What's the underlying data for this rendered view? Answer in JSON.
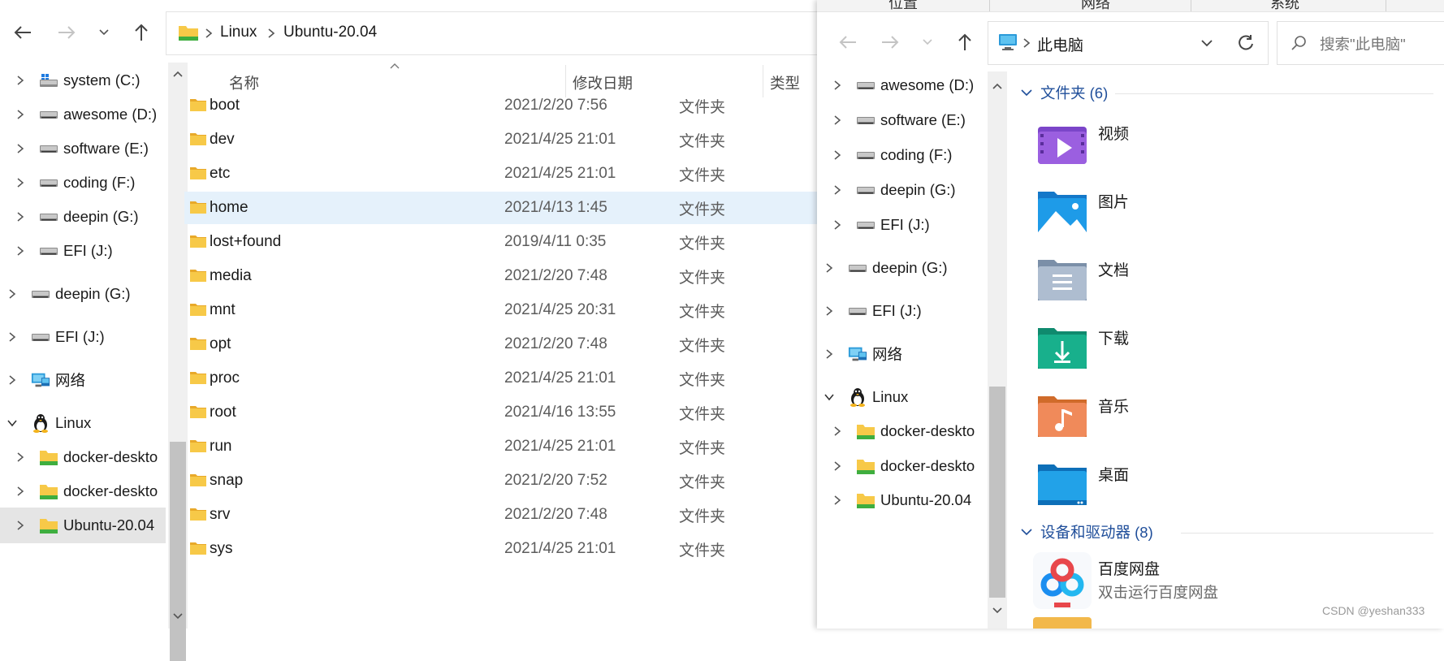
{
  "left_window": {
    "breadcrumb": [
      "Linux",
      "Ubuntu-20.04"
    ],
    "nav_tree": [
      {
        "label": "system (C:)",
        "icon": "windows-drive-icon",
        "level": 1,
        "expanded": false
      },
      {
        "label": "awesome (D:)",
        "icon": "drive-icon",
        "level": 1,
        "expanded": false
      },
      {
        "label": "software (E:)",
        "icon": "drive-icon",
        "level": 1,
        "expanded": false
      },
      {
        "label": "coding (F:)",
        "icon": "drive-icon",
        "level": 1,
        "expanded": false
      },
      {
        "label": "deepin (G:)",
        "icon": "drive-icon",
        "level": 1,
        "expanded": false
      },
      {
        "label": "EFI (J:)",
        "icon": "drive-icon",
        "level": 1,
        "expanded": false
      },
      {
        "label": "deepin (G:)",
        "icon": "drive-icon",
        "level": 0,
        "expanded": false
      },
      {
        "label": "EFI (J:)",
        "icon": "drive-icon",
        "level": 0,
        "expanded": false
      },
      {
        "label": "网络",
        "icon": "network-icon",
        "level": 0,
        "expanded": false
      },
      {
        "label": "Linux",
        "icon": "linux-penguin-icon",
        "level": 0,
        "expanded": true
      },
      {
        "label": "docker-deskto",
        "icon": "wsl-folder-icon",
        "level": 1,
        "expanded": false
      },
      {
        "label": "docker-deskto",
        "icon": "wsl-folder-icon",
        "level": 1,
        "expanded": false
      },
      {
        "label": "Ubuntu-20.04",
        "icon": "wsl-folder-icon",
        "level": 1,
        "expanded": false,
        "selected": true
      }
    ],
    "columns": {
      "name": "名称",
      "date": "修改日期",
      "type": "类型"
    },
    "files": [
      {
        "name": "boot",
        "date": "2021/2/20 7:56",
        "type": "文件夹"
      },
      {
        "name": "dev",
        "date": "2021/4/25 21:01",
        "type": "文件夹"
      },
      {
        "name": "etc",
        "date": "2021/4/25 21:01",
        "type": "文件夹"
      },
      {
        "name": "home",
        "date": "2021/4/13 1:45",
        "type": "文件夹",
        "selected": true
      },
      {
        "name": "lost+found",
        "date": "2019/4/11 0:35",
        "type": "文件夹"
      },
      {
        "name": "media",
        "date": "2021/2/20 7:48",
        "type": "文件夹"
      },
      {
        "name": "mnt",
        "date": "2021/4/25 20:31",
        "type": "文件夹"
      },
      {
        "name": "opt",
        "date": "2021/2/20 7:48",
        "type": "文件夹"
      },
      {
        "name": "proc",
        "date": "2021/4/25 21:01",
        "type": "文件夹"
      },
      {
        "name": "root",
        "date": "2021/4/16 13:55",
        "type": "文件夹"
      },
      {
        "name": "run",
        "date": "2021/4/25 21:01",
        "type": "文件夹"
      },
      {
        "name": "snap",
        "date": "2021/2/20 7:52",
        "type": "文件夹"
      },
      {
        "name": "srv",
        "date": "2021/2/20 7:48",
        "type": "文件夹"
      },
      {
        "name": "sys",
        "date": "2021/4/25 21:01",
        "type": "文件夹"
      }
    ]
  },
  "right_window": {
    "tabs": [
      "位置",
      "网络",
      "系统"
    ],
    "address": "此电脑",
    "search_placeholder": "搜索\"此电脑\"",
    "nav_tree": [
      {
        "label": "awesome (D:)",
        "icon": "drive-icon",
        "level": 1
      },
      {
        "label": "software (E:)",
        "icon": "drive-icon",
        "level": 1
      },
      {
        "label": "coding (F:)",
        "icon": "drive-icon",
        "level": 1
      },
      {
        "label": "deepin (G:)",
        "icon": "drive-icon",
        "level": 1
      },
      {
        "label": "EFI (J:)",
        "icon": "drive-icon",
        "level": 1
      },
      {
        "label": "deepin (G:)",
        "icon": "drive-icon",
        "level": 0
      },
      {
        "label": "EFI (J:)",
        "icon": "drive-icon",
        "level": 0
      },
      {
        "label": "网络",
        "icon": "network-icon",
        "level": 0
      },
      {
        "label": "Linux",
        "icon": "linux-penguin-icon",
        "level": 0,
        "expanded": true
      },
      {
        "label": "docker-deskto",
        "icon": "wsl-folder-icon",
        "level": 1
      },
      {
        "label": "docker-deskto",
        "icon": "wsl-folder-icon",
        "level": 1
      },
      {
        "label": "Ubuntu-20.04",
        "icon": "wsl-folder-icon",
        "level": 1
      }
    ],
    "folders_group": {
      "title": "文件夹 (6)"
    },
    "folders": [
      {
        "label": "视频",
        "icon": "videos-folder-icon"
      },
      {
        "label": "图片",
        "icon": "pictures-folder-icon"
      },
      {
        "label": "文档",
        "icon": "documents-folder-icon"
      },
      {
        "label": "下载",
        "icon": "downloads-folder-icon"
      },
      {
        "label": "音乐",
        "icon": "music-folder-icon"
      },
      {
        "label": "桌面",
        "icon": "desktop-folder-icon"
      }
    ],
    "devices_group": {
      "title": "设备和驱动器 (8)"
    },
    "devices": [
      {
        "name": "百度网盘",
        "subtitle": "双击运行百度网盘",
        "icon": "baidu-netdisk-icon"
      }
    ]
  },
  "watermark": "CSDN @yeshan333",
  "colors": {
    "accent": "#1f4e9a",
    "selection": "#e5f1fb",
    "tree_selected": "#e5e5e5",
    "folder_yellow": "#f7c948",
    "wsl_green": "#3fae3f"
  }
}
